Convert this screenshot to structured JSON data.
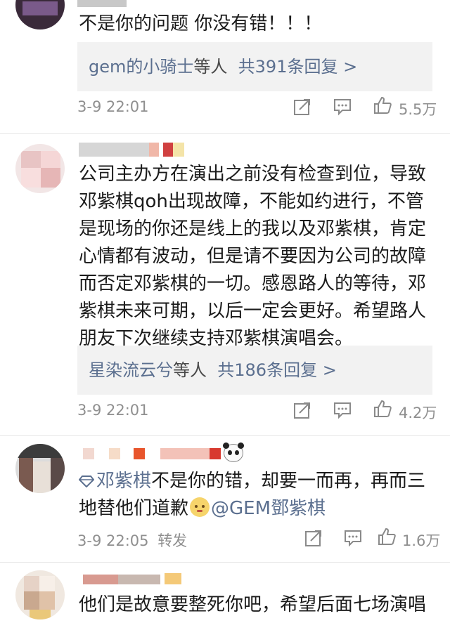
{
  "comments": [
    {
      "text": "不是你的问题 你没有错！！！",
      "reply_users": "gem的小骑士",
      "reply_etc": "等人",
      "reply_count": "共391条回复 >",
      "time": "3-9 22:01",
      "likes": "5.5万"
    },
    {
      "text": "公司主办方在演出之前没有检查到位，导致邓紫棋qoh出现故障，不能如约进行，不管是现场的你还是线上的我以及邓紫棋，肯定心情都有波动，但是请不要因为公司的故障而否定邓紫棋的一切。感恩路人的等待，邓紫棋未来可期，以后一定会更好。希望路人朋友下次继续支持邓紫棋演唱会。",
      "reply_users": "星染流云兮",
      "reply_etc": "等人",
      "reply_count": "共186条回复 >",
      "time": "3-9 22:01",
      "likes": "4.2万"
    },
    {
      "mention1": "邓紫棋",
      "text_a": "不是你的错，却要一而再，再而三",
      "text_b": "地替他们道歉",
      "mention2": "@GEM鄧紫棋",
      "time": "3-9 22:05",
      "forward": "转发",
      "likes": "1.6万"
    },
    {
      "text": "他们是故意要整死你吧，希望后面七场演唱"
    }
  ],
  "icons": [
    "share-icon",
    "comment-icon",
    "like-icon"
  ],
  "colors": {
    "link": "#5b6f8f",
    "meta": "#8f8f8f",
    "reply_bg": "#f2f2f2"
  }
}
